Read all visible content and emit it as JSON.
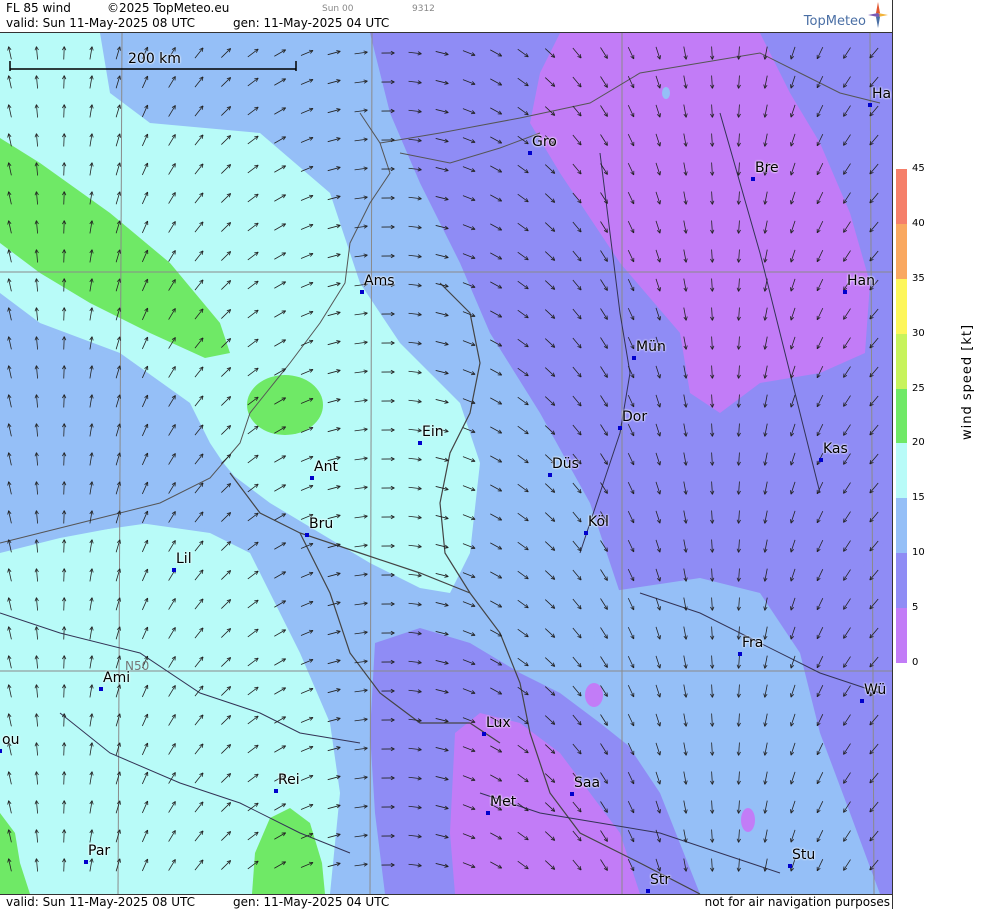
{
  "header": {
    "title": "FL 85 wind",
    "copyright": "©2025 TopMeteo.eu",
    "run": "Sun 00",
    "code": "9312",
    "valid": "valid:  Sun  11-May-2025  08 UTC",
    "gen": "gen: 11-May-2025 04 UTC",
    "brand": "TopMeteo"
  },
  "footer": {
    "valid": "valid:  Sun  11-May-2025  08 UTC",
    "gen": "gen: 11-May-2025 04 UTC",
    "disclaimer": "not for air navigation purposes"
  },
  "scale": {
    "label": "200 km"
  },
  "grid": {
    "lat_label": "N50"
  },
  "legend": {
    "title": "wind  speed  [kt]",
    "ticks": [
      "45",
      "40",
      "35",
      "30",
      "25",
      "20",
      "15",
      "10",
      "5",
      "0"
    ],
    "bands": [
      {
        "range": "40-45",
        "color": "#f57f6a"
      },
      {
        "range": "35-40",
        "color": "#f9a860"
      },
      {
        "range": "30-35",
        "color": "#fdf65a"
      },
      {
        "range": "25-30",
        "color": "#c7f35c"
      },
      {
        "range": "20-25",
        "color": "#6fe966"
      },
      {
        "range": "15-20",
        "color": "#b8fbf8"
      },
      {
        "range": "10-15",
        "color": "#95bff7"
      },
      {
        "range": "5-10",
        "color": "#8f8cf5"
      },
      {
        "range": "0-5",
        "color": "#c27cf7"
      }
    ]
  },
  "cities": [
    {
      "name": "Gro",
      "id": "groningen"
    },
    {
      "name": "Bre",
      "id": "bremen"
    },
    {
      "name": "Ha",
      "id": "hamburg"
    },
    {
      "name": "Ams",
      "id": "amsterdam"
    },
    {
      "name": "Han",
      "id": "hannover"
    },
    {
      "name": "Mün",
      "id": "muenster"
    },
    {
      "name": "Dor",
      "id": "dortmund"
    },
    {
      "name": "Ein",
      "id": "eindhoven"
    },
    {
      "name": "Kas",
      "id": "kassel"
    },
    {
      "name": "Ant",
      "id": "antwerp"
    },
    {
      "name": "Düs",
      "id": "duesseldorf"
    },
    {
      "name": "Köl",
      "id": "koeln"
    },
    {
      "name": "Bru",
      "id": "brussels"
    },
    {
      "name": "Lil",
      "id": "lille"
    },
    {
      "name": "Fra",
      "id": "frankfurt"
    },
    {
      "name": "Ami",
      "id": "amiens"
    },
    {
      "name": "Wü",
      "id": "wuerzburg"
    },
    {
      "name": "Lux",
      "id": "luxembourg"
    },
    {
      "name": "ou",
      "id": "rouen"
    },
    {
      "name": "Rei",
      "id": "reims"
    },
    {
      "name": "Saa",
      "id": "saarbruecken"
    },
    {
      "name": "Met",
      "id": "metz"
    },
    {
      "name": "Par",
      "id": "paris"
    },
    {
      "name": "Stu",
      "id": "stuttgart"
    },
    {
      "name": "Str",
      "id": "strasbourg"
    }
  ]
}
